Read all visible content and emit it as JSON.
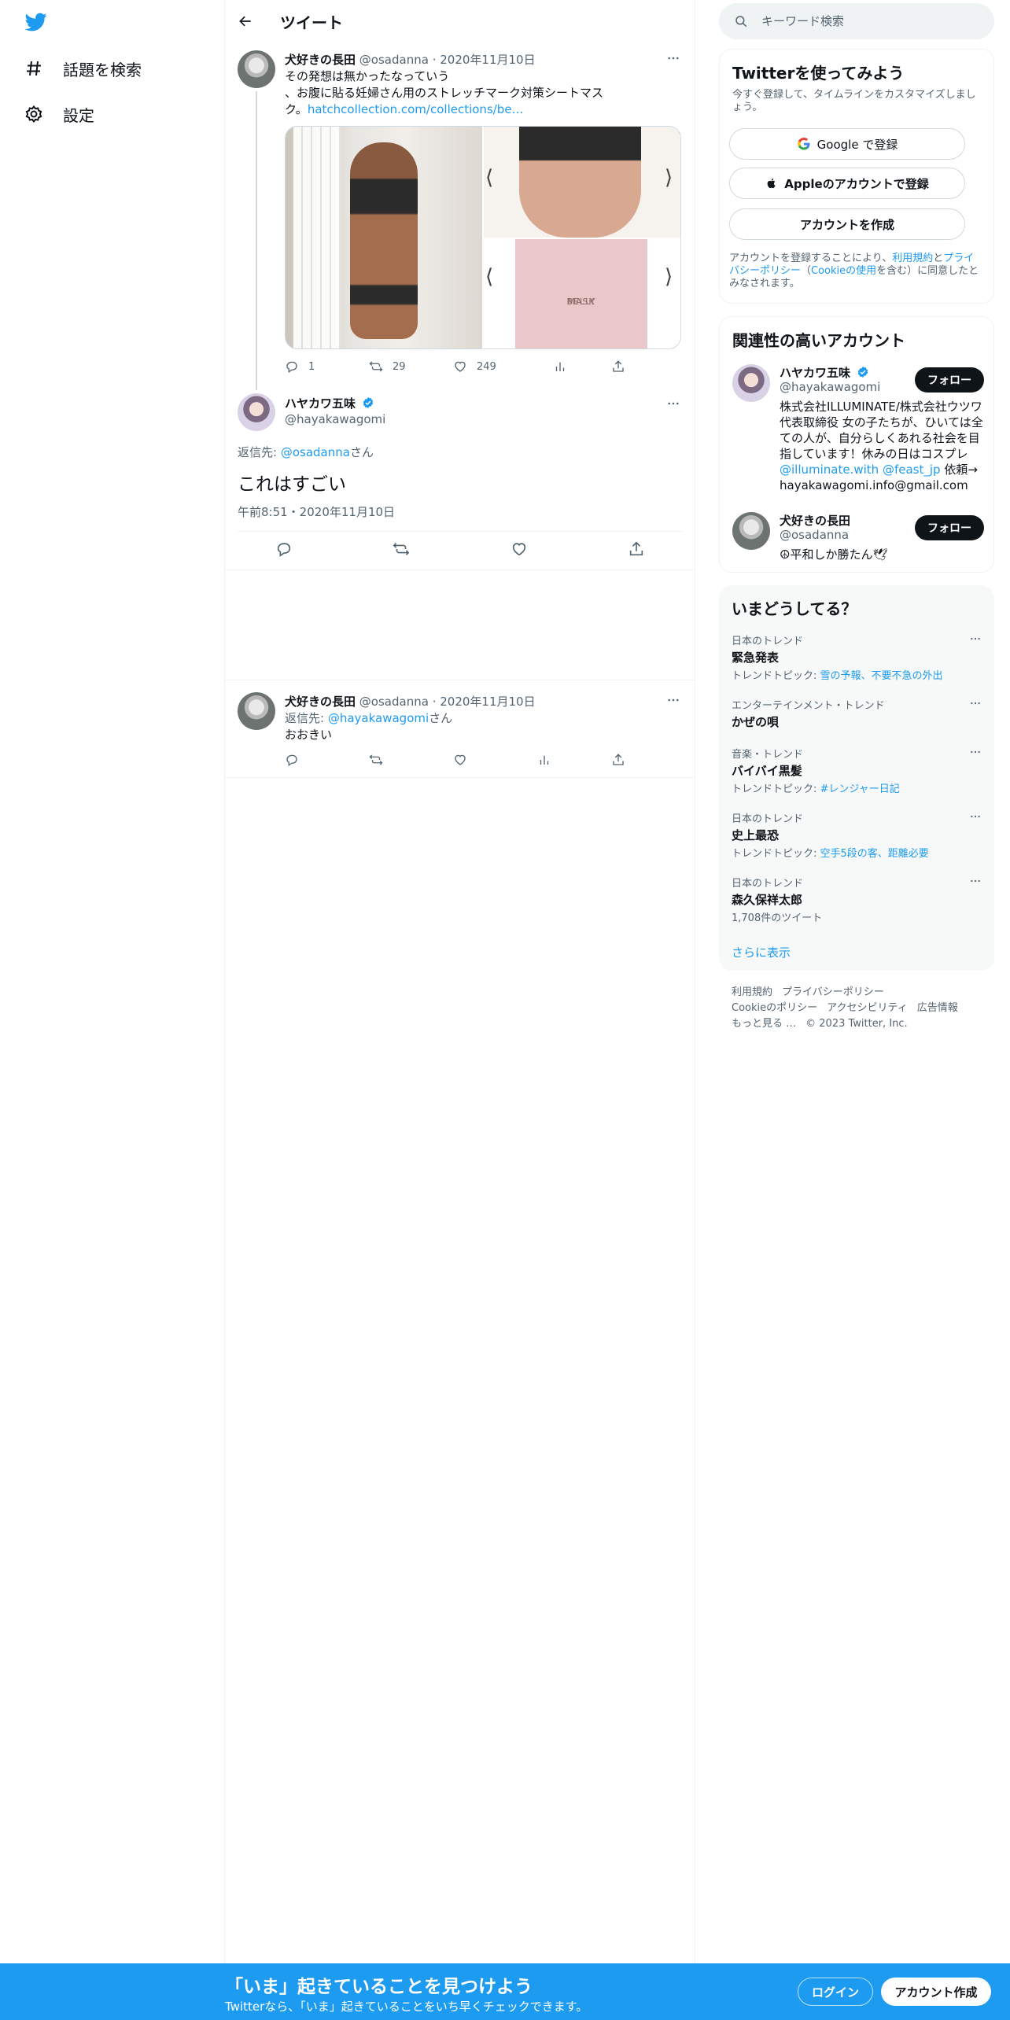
{
  "nav": {
    "items": [
      {
        "label": "話題を検索",
        "icon": "hashtag-icon"
      },
      {
        "label": "設定",
        "icon": "gear-icon"
      }
    ]
  },
  "header": {
    "title": "ツイート"
  },
  "tweet1": {
    "name": "犬好きの長田",
    "handle": "@osadanna",
    "date": "2020年11月10日",
    "text_line1": "その発想は無かったなっていう",
    "text_line2": "、お腹に貼る妊婦さん用のストレッチマーク対策シートマス",
    "text_line3_prefix": "ク。",
    "link": "hatchcollection.com/collections/be…",
    "image_box_text_1": "BELLY",
    "image_box_text_2": "MASK",
    "replies": "1",
    "retweets": "29",
    "likes": "249"
  },
  "main_tweet": {
    "name": "ハヤカワ五味",
    "handle": "@hayakawagomi",
    "reply_to_label": "返信先: ",
    "reply_to_handle": "@osadanna",
    "reply_to_suffix": "さん",
    "text": "これはすごい",
    "timestamp": "午前8:51・2020年11月10日"
  },
  "tweet3": {
    "name": "犬好きの長田",
    "handle": "@osadanna",
    "date": "2020年11月10日",
    "reply_to_label": "返信先: ",
    "reply_to_handle": "@hayakawagomi",
    "reply_to_suffix": "さん",
    "text": "おおきい"
  },
  "search": {
    "placeholder": "キーワード検索"
  },
  "signup_card": {
    "title": "Twitterを使ってみよう",
    "subtitle": "今すぐ登録して、タイムラインをカスタマイズしましょう。",
    "google_label": "Google で登録",
    "apple_label": "Appleのアカウントで登録",
    "create_label": "アカウントを作成",
    "legal_1": "アカウントを登録することにより、",
    "legal_terms": "利用規約",
    "legal_2": "と",
    "legal_privacy": "プライバシーポリシー",
    "legal_3": "（",
    "legal_cookie": "Cookieの使用",
    "legal_4": "を含む）に同意したとみなされます。"
  },
  "related": {
    "title": "関連性の高いアカウント",
    "accounts": [
      {
        "name": "ハヤカワ五味",
        "handle": "@hayakawagomi",
        "bio_1": "株式会社ILLUMINATE/株式会社ウツワ 代表取締役 女の子たちが、ひいては全ての人が、自分らしくあれる社会を目指しています！休みの日はコスプレ ",
        "bio_link1": "@illuminate.with",
        "bio_link2": "@feast_jp",
        "bio_2": " 依頼→ hayakawagomi.info@gmail.com",
        "follow": "フォロー"
      },
      {
        "name": "犬好きの長田",
        "handle": "@osadanna",
        "bio": "☮平和しか勝たん🕊",
        "follow": "フォロー"
      }
    ]
  },
  "trends": {
    "title": "いまどうしてる？",
    "items": [
      {
        "context": "日本のトレンド",
        "name": "緊急発表",
        "topic_label": "トレンドトピック: ",
        "topic": "雪の予報、不要不急の外出"
      },
      {
        "context": "エンターテインメント・トレンド",
        "name": "かぜの唄"
      },
      {
        "context": "音楽・トレンド",
        "name": "バイバイ黒髪",
        "topic_label": "トレンドトピック: ",
        "topic": "#レンジャー日記"
      },
      {
        "context": "日本のトレンド",
        "name": "史上最恐",
        "topic_label": "トレンドトピック: ",
        "topic": "空手5段の客、距離必要"
      },
      {
        "context": "日本のトレンド",
        "name": "森久保祥太郎",
        "count": "1,708件のツイート"
      }
    ],
    "show_more": "さらに表示"
  },
  "footer": {
    "terms": "利用規約",
    "privacy": "プライバシーポリシー",
    "cookie": "Cookieのポリシー",
    "accessibility": "アクセシビリティ",
    "ads": "広告情報",
    "more": "もっと見る …",
    "copyright": "© 2023 Twitter, Inc."
  },
  "bottom_bar": {
    "headline": "「いま」起きていることを見つけよう",
    "sub": "Twitterなら、「いま」起きていることをいち早くチェックできます。",
    "login": "ログイン",
    "signup": "アカウント作成"
  },
  "colors": {
    "accent": "#1d9bf0",
    "text": "#0f1419",
    "muted": "#536471",
    "border": "#eff3f4"
  }
}
